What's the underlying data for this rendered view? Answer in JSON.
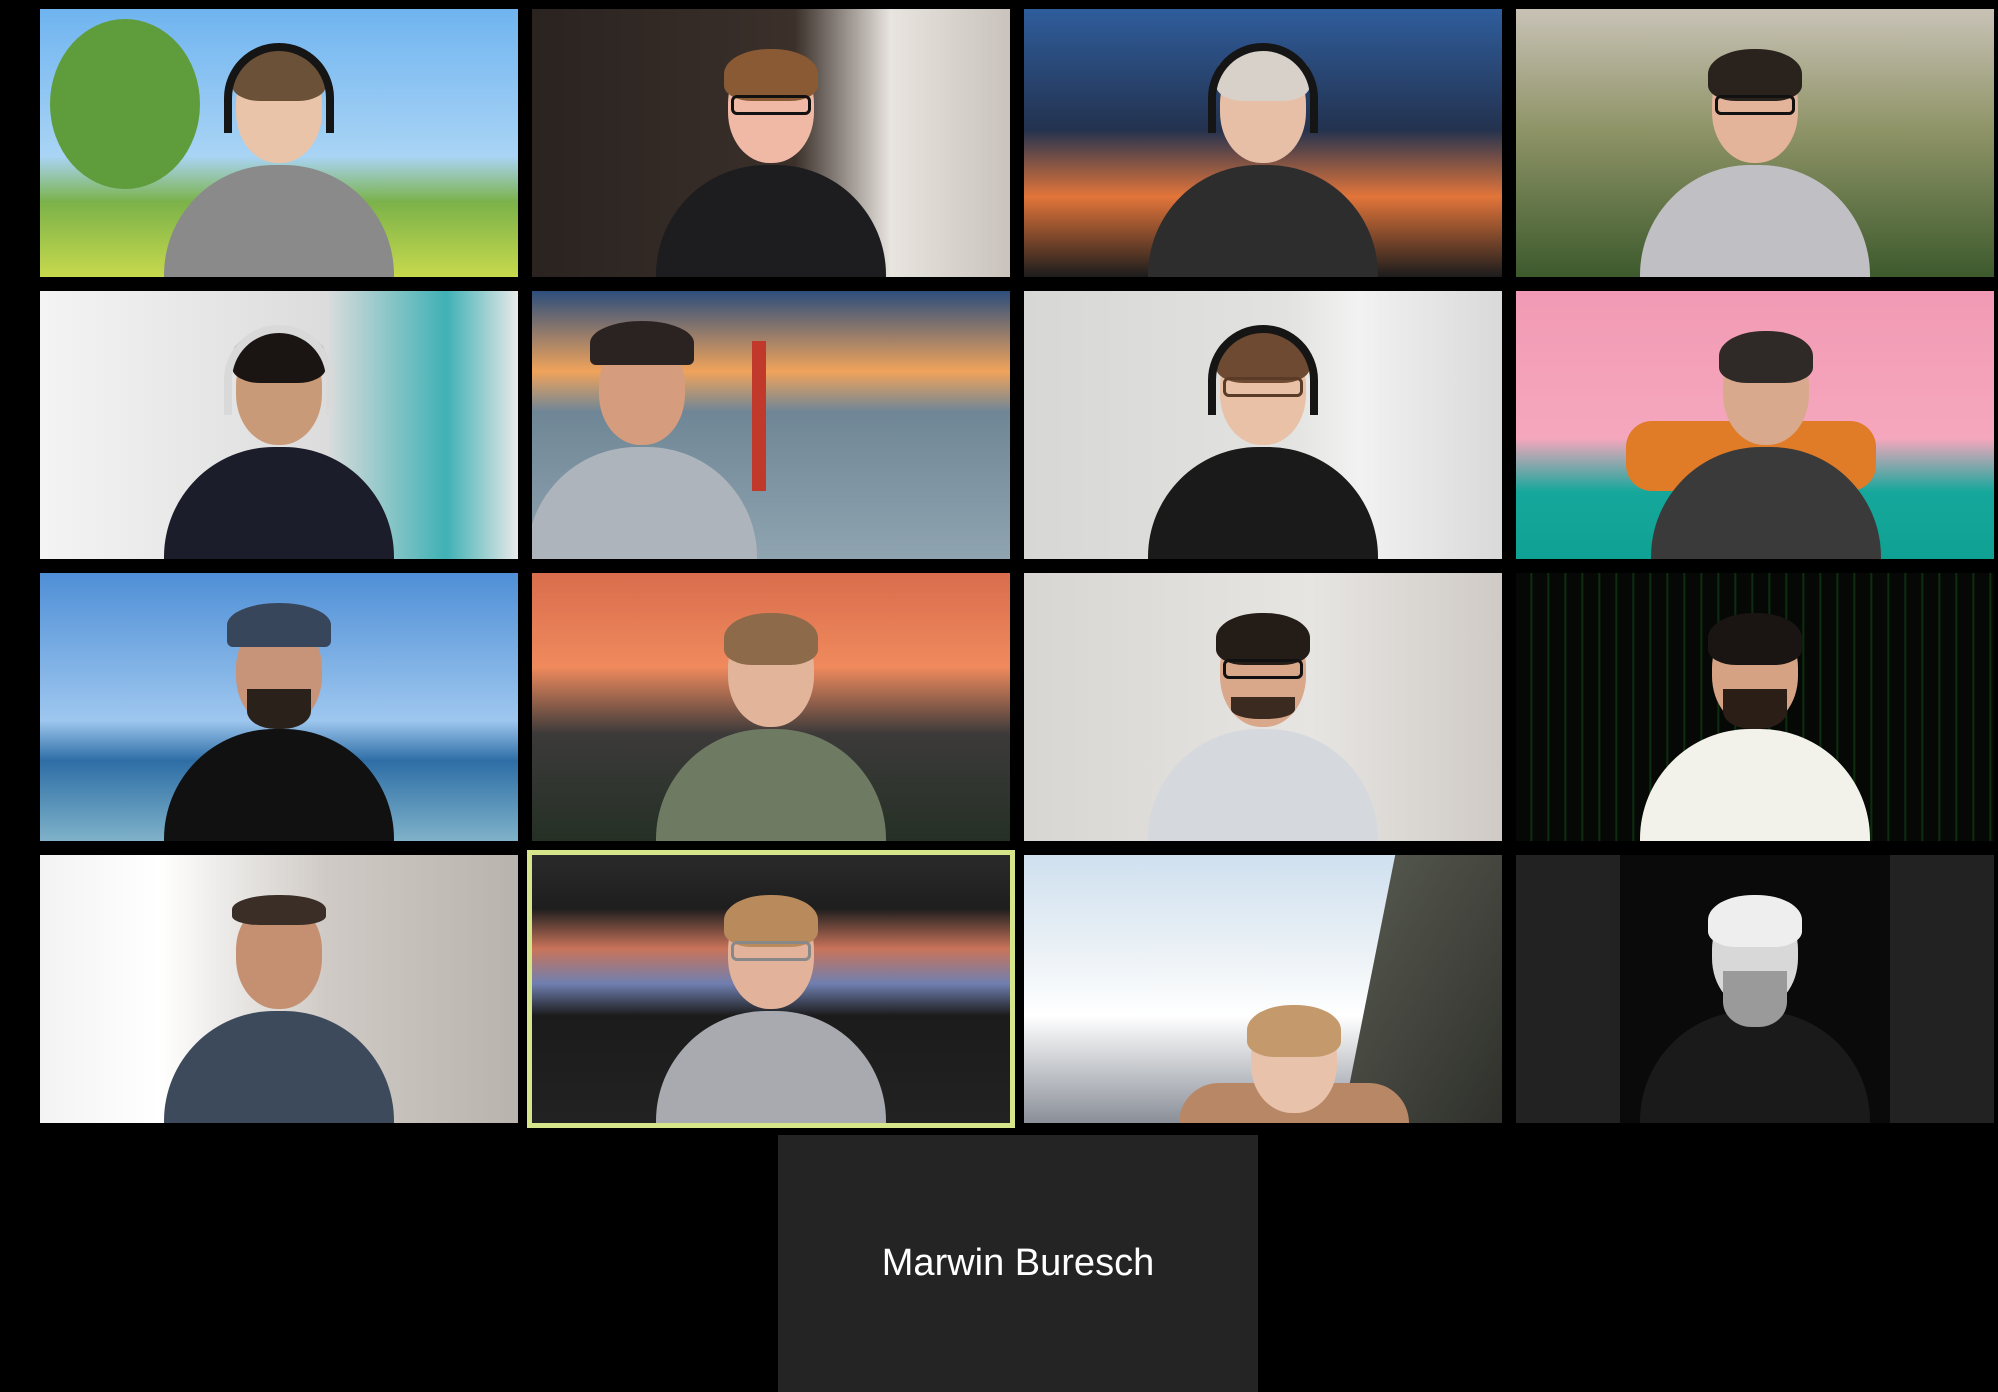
{
  "app": {
    "view": "gallery"
  },
  "participants": [
    {
      "id": "p1"
    },
    {
      "id": "p2"
    },
    {
      "id": "p3"
    },
    {
      "id": "p4"
    },
    {
      "id": "p5"
    },
    {
      "id": "p6"
    },
    {
      "id": "p7"
    },
    {
      "id": "p8"
    },
    {
      "id": "p9"
    },
    {
      "id": "p10"
    },
    {
      "id": "p11"
    },
    {
      "id": "p12"
    },
    {
      "id": "p13"
    },
    {
      "id": "p14",
      "active_speaker": true
    },
    {
      "id": "p15"
    },
    {
      "id": "p16"
    }
  ],
  "name_tile": {
    "name": "Marwin Buresch"
  },
  "colors": {
    "background": "#000000",
    "tile": "#242424",
    "active_speaker_border": "#d6e58a",
    "name_text": "#ffffff"
  }
}
